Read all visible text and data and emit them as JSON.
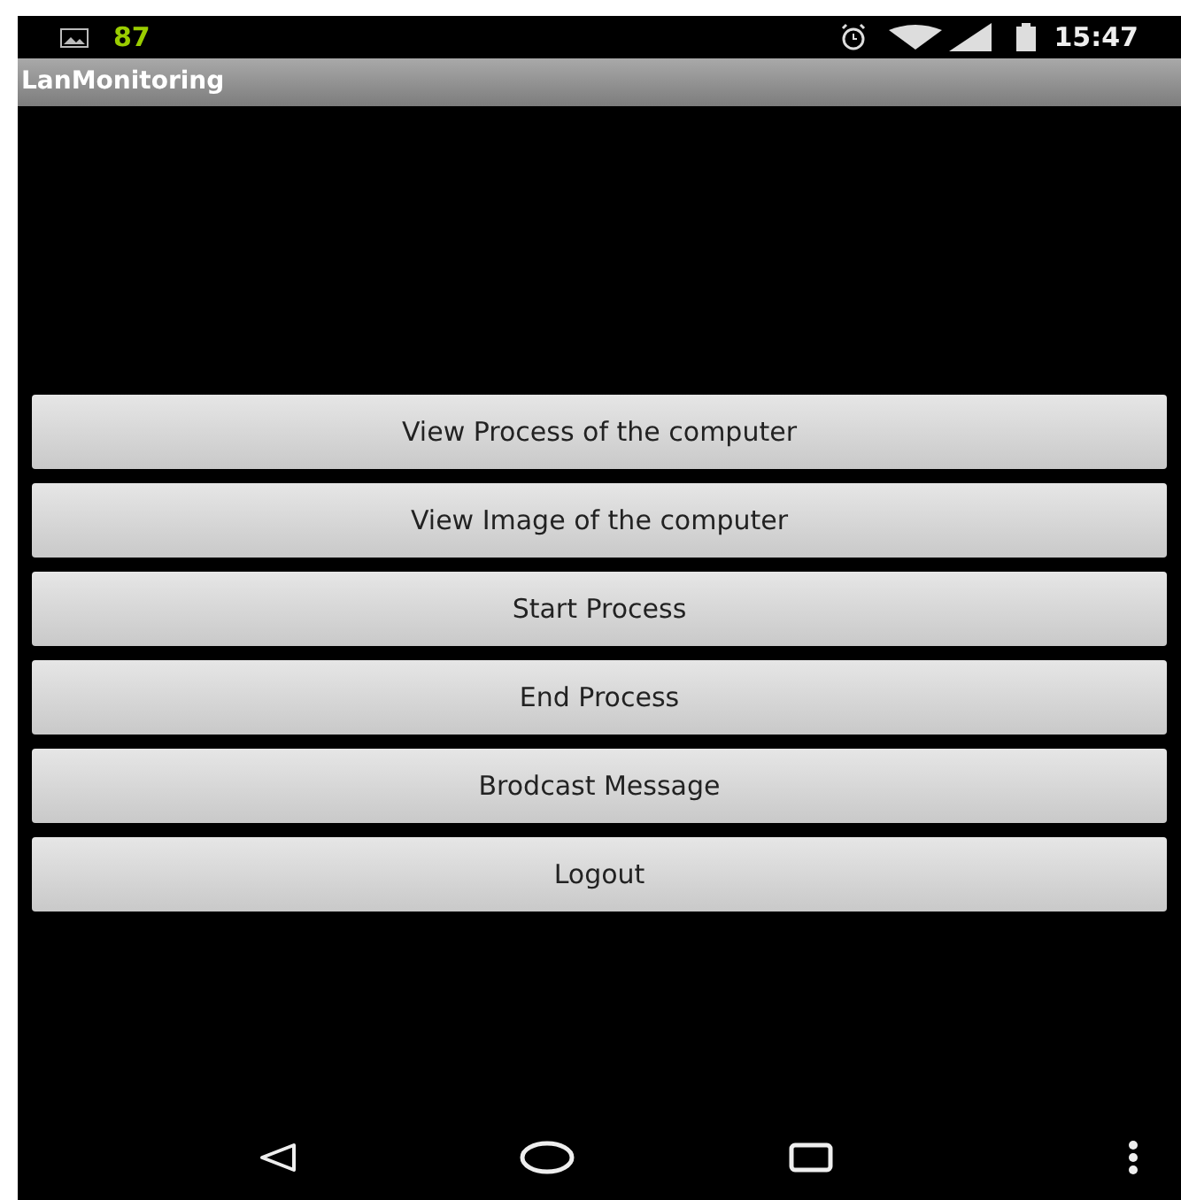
{
  "status_bar": {
    "notification_count": "87",
    "time": "15:47"
  },
  "app_bar": {
    "title": "LanMonitoring"
  },
  "buttons": [
    "View Process of the computer",
    "View Image of the computer",
    "Start Process",
    "End Process",
    "Brodcast Message",
    "Logout"
  ]
}
